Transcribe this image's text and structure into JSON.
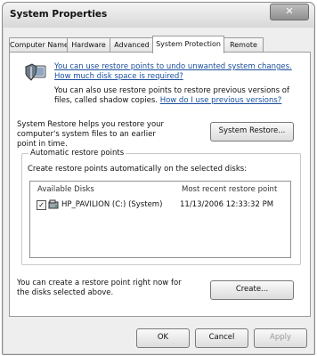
{
  "window": {
    "title": "System Properties",
    "close_glyph": "✕"
  },
  "tabs": [
    {
      "label": "Computer Name"
    },
    {
      "label": "Hardware"
    },
    {
      "label": "Advanced"
    },
    {
      "label": "System Protection"
    },
    {
      "label": "Remote"
    }
  ],
  "protection": {
    "intro_lead": "You can use restore points to undo unwanted system changes.",
    "intro_link": "How much disk space is required?",
    "shadow_text": "You can also use restore points to restore previous versions of files, called shadow copies.",
    "shadow_link": "How do I use previous versions?",
    "restore_text": "System Restore helps you restore your computer's system files to an earlier point in time.",
    "restore_button": "System Restore...",
    "auto_group_label": "Automatic restore points",
    "auto_desc": "Create restore points automatically on the selected disks:",
    "col_disks": "Available Disks",
    "col_recent": "Most recent restore point",
    "disks": [
      {
        "name": "HP_PAVILION (C:) (System)",
        "recent": "11/13/2006 12:33:32 PM",
        "checked": "✓"
      }
    ],
    "create_text": "You can create a restore point right now for the disks selected above.",
    "create_button": "Create..."
  },
  "footer": {
    "ok": "OK",
    "cancel": "Cancel",
    "apply": "Apply"
  }
}
